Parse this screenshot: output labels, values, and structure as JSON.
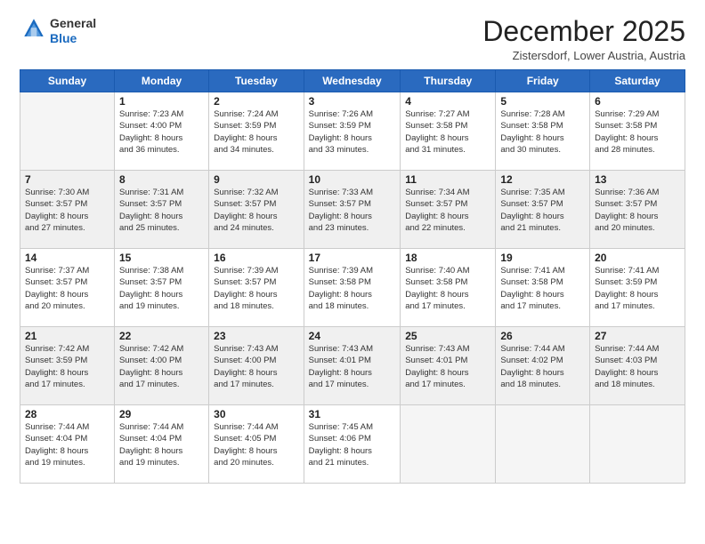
{
  "header": {
    "logo_line1": "General",
    "logo_line2": "Blue",
    "month_title": "December 2025",
    "location": "Zistersdorf, Lower Austria, Austria"
  },
  "weekdays": [
    "Sunday",
    "Monday",
    "Tuesday",
    "Wednesday",
    "Thursday",
    "Friday",
    "Saturday"
  ],
  "weeks": [
    [
      {
        "day": "",
        "info": ""
      },
      {
        "day": "1",
        "info": "Sunrise: 7:23 AM\nSunset: 4:00 PM\nDaylight: 8 hours\nand 36 minutes."
      },
      {
        "day": "2",
        "info": "Sunrise: 7:24 AM\nSunset: 3:59 PM\nDaylight: 8 hours\nand 34 minutes."
      },
      {
        "day": "3",
        "info": "Sunrise: 7:26 AM\nSunset: 3:59 PM\nDaylight: 8 hours\nand 33 minutes."
      },
      {
        "day": "4",
        "info": "Sunrise: 7:27 AM\nSunset: 3:58 PM\nDaylight: 8 hours\nand 31 minutes."
      },
      {
        "day": "5",
        "info": "Sunrise: 7:28 AM\nSunset: 3:58 PM\nDaylight: 8 hours\nand 30 minutes."
      },
      {
        "day": "6",
        "info": "Sunrise: 7:29 AM\nSunset: 3:58 PM\nDaylight: 8 hours\nand 28 minutes."
      }
    ],
    [
      {
        "day": "7",
        "info": "Sunrise: 7:30 AM\nSunset: 3:57 PM\nDaylight: 8 hours\nand 27 minutes."
      },
      {
        "day": "8",
        "info": "Sunrise: 7:31 AM\nSunset: 3:57 PM\nDaylight: 8 hours\nand 25 minutes."
      },
      {
        "day": "9",
        "info": "Sunrise: 7:32 AM\nSunset: 3:57 PM\nDaylight: 8 hours\nand 24 minutes."
      },
      {
        "day": "10",
        "info": "Sunrise: 7:33 AM\nSunset: 3:57 PM\nDaylight: 8 hours\nand 23 minutes."
      },
      {
        "day": "11",
        "info": "Sunrise: 7:34 AM\nSunset: 3:57 PM\nDaylight: 8 hours\nand 22 minutes."
      },
      {
        "day": "12",
        "info": "Sunrise: 7:35 AM\nSunset: 3:57 PM\nDaylight: 8 hours\nand 21 minutes."
      },
      {
        "day": "13",
        "info": "Sunrise: 7:36 AM\nSunset: 3:57 PM\nDaylight: 8 hours\nand 20 minutes."
      }
    ],
    [
      {
        "day": "14",
        "info": "Sunrise: 7:37 AM\nSunset: 3:57 PM\nDaylight: 8 hours\nand 20 minutes."
      },
      {
        "day": "15",
        "info": "Sunrise: 7:38 AM\nSunset: 3:57 PM\nDaylight: 8 hours\nand 19 minutes."
      },
      {
        "day": "16",
        "info": "Sunrise: 7:39 AM\nSunset: 3:57 PM\nDaylight: 8 hours\nand 18 minutes."
      },
      {
        "day": "17",
        "info": "Sunrise: 7:39 AM\nSunset: 3:58 PM\nDaylight: 8 hours\nand 18 minutes."
      },
      {
        "day": "18",
        "info": "Sunrise: 7:40 AM\nSunset: 3:58 PM\nDaylight: 8 hours\nand 17 minutes."
      },
      {
        "day": "19",
        "info": "Sunrise: 7:41 AM\nSunset: 3:58 PM\nDaylight: 8 hours\nand 17 minutes."
      },
      {
        "day": "20",
        "info": "Sunrise: 7:41 AM\nSunset: 3:59 PM\nDaylight: 8 hours\nand 17 minutes."
      }
    ],
    [
      {
        "day": "21",
        "info": "Sunrise: 7:42 AM\nSunset: 3:59 PM\nDaylight: 8 hours\nand 17 minutes."
      },
      {
        "day": "22",
        "info": "Sunrise: 7:42 AM\nSunset: 4:00 PM\nDaylight: 8 hours\nand 17 minutes."
      },
      {
        "day": "23",
        "info": "Sunrise: 7:43 AM\nSunset: 4:00 PM\nDaylight: 8 hours\nand 17 minutes."
      },
      {
        "day": "24",
        "info": "Sunrise: 7:43 AM\nSunset: 4:01 PM\nDaylight: 8 hours\nand 17 minutes."
      },
      {
        "day": "25",
        "info": "Sunrise: 7:43 AM\nSunset: 4:01 PM\nDaylight: 8 hours\nand 17 minutes."
      },
      {
        "day": "26",
        "info": "Sunrise: 7:44 AM\nSunset: 4:02 PM\nDaylight: 8 hours\nand 18 minutes."
      },
      {
        "day": "27",
        "info": "Sunrise: 7:44 AM\nSunset: 4:03 PM\nDaylight: 8 hours\nand 18 minutes."
      }
    ],
    [
      {
        "day": "28",
        "info": "Sunrise: 7:44 AM\nSunset: 4:04 PM\nDaylight: 8 hours\nand 19 minutes."
      },
      {
        "day": "29",
        "info": "Sunrise: 7:44 AM\nSunset: 4:04 PM\nDaylight: 8 hours\nand 19 minutes."
      },
      {
        "day": "30",
        "info": "Sunrise: 7:44 AM\nSunset: 4:05 PM\nDaylight: 8 hours\nand 20 minutes."
      },
      {
        "day": "31",
        "info": "Sunrise: 7:45 AM\nSunset: 4:06 PM\nDaylight: 8 hours\nand 21 minutes."
      },
      {
        "day": "",
        "info": ""
      },
      {
        "day": "",
        "info": ""
      },
      {
        "day": "",
        "info": ""
      }
    ]
  ]
}
